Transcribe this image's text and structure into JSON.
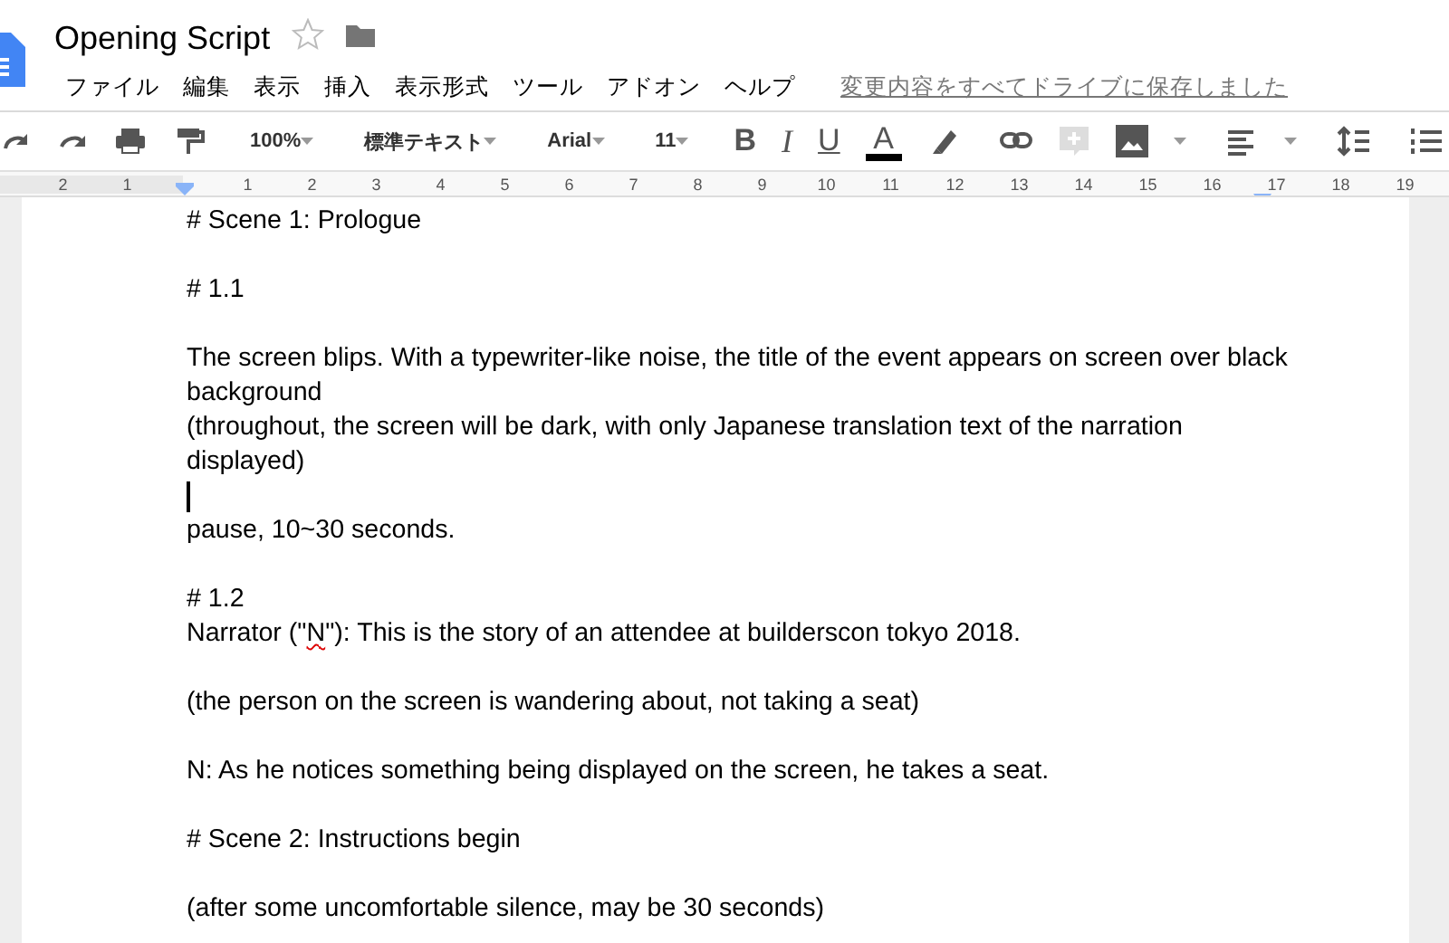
{
  "title": "Opening Script",
  "starred": false,
  "menu": [
    "ファイル",
    "編集",
    "表示",
    "挿入",
    "表示形式",
    "ツール",
    "アドオン",
    "ヘルプ"
  ],
  "save_status": "変更内容をすべてドライブに保存しました",
  "toolbar": {
    "zoom": "100%",
    "style": "標準テキスト",
    "font": "Arial",
    "size": "11",
    "format_buttons": [
      {
        "kind": "bold",
        "label": "B",
        "selected": false
      },
      {
        "kind": "italic",
        "label": "I",
        "selected": false
      },
      {
        "kind": "underline",
        "label": "U",
        "selected": false
      },
      {
        "kind": "text_color",
        "label": "A",
        "selected": false
      }
    ]
  },
  "ruler": {
    "left_numbers": [
      "2",
      "1"
    ],
    "numbers": [
      "1",
      "2",
      "3",
      "4",
      "5",
      "6",
      "7",
      "8",
      "9",
      "10",
      "11",
      "12",
      "13",
      "14",
      "15",
      "16",
      "17",
      "18",
      "19"
    ]
  },
  "paragraphs": [
    {
      "kind": "text",
      "segments": [
        {
          "text": "# Scene 1: Prologue"
        }
      ]
    },
    {
      "kind": "blank"
    },
    {
      "kind": "text",
      "segments": [
        {
          "text": "# 1.1"
        }
      ]
    },
    {
      "kind": "blank"
    },
    {
      "kind": "text",
      "segments": [
        {
          "text": "The screen blips. With a typewriter-like noise, the title of the event appears on screen over black background"
        }
      ]
    },
    {
      "kind": "text",
      "segments": [
        {
          "text": "(throughout, the screen will be dark, with only Japanese translation text of the narration displayed)"
        }
      ]
    },
    {
      "kind": "cursor"
    },
    {
      "kind": "text",
      "segments": [
        {
          "text": "pause, 10~30 seconds."
        }
      ]
    },
    {
      "kind": "blank"
    },
    {
      "kind": "text",
      "segments": [
        {
          "text": "# 1.2"
        }
      ]
    },
    {
      "kind": "text",
      "segments": [
        {
          "text": "Narrator (\""
        },
        {
          "text": "N",
          "misspelled": true
        },
        {
          "text": "\"): This is the story of an attendee at builderscon tokyo 2018."
        }
      ]
    },
    {
      "kind": "blank"
    },
    {
      "kind": "text",
      "segments": [
        {
          "text": "(the person on the screen is wandering about, not taking a seat)"
        }
      ]
    },
    {
      "kind": "blank"
    },
    {
      "kind": "text",
      "segments": [
        {
          "text": "N: As he notices something being displayed on the screen, he takes a seat."
        }
      ]
    },
    {
      "kind": "blank"
    },
    {
      "kind": "text",
      "segments": [
        {
          "text": "# Scene 2: Instructions begin"
        }
      ]
    },
    {
      "kind": "blank"
    },
    {
      "kind": "text",
      "segments": [
        {
          "text": "(after some uncomfortable silence, may be 30 seconds)"
        }
      ]
    }
  ]
}
